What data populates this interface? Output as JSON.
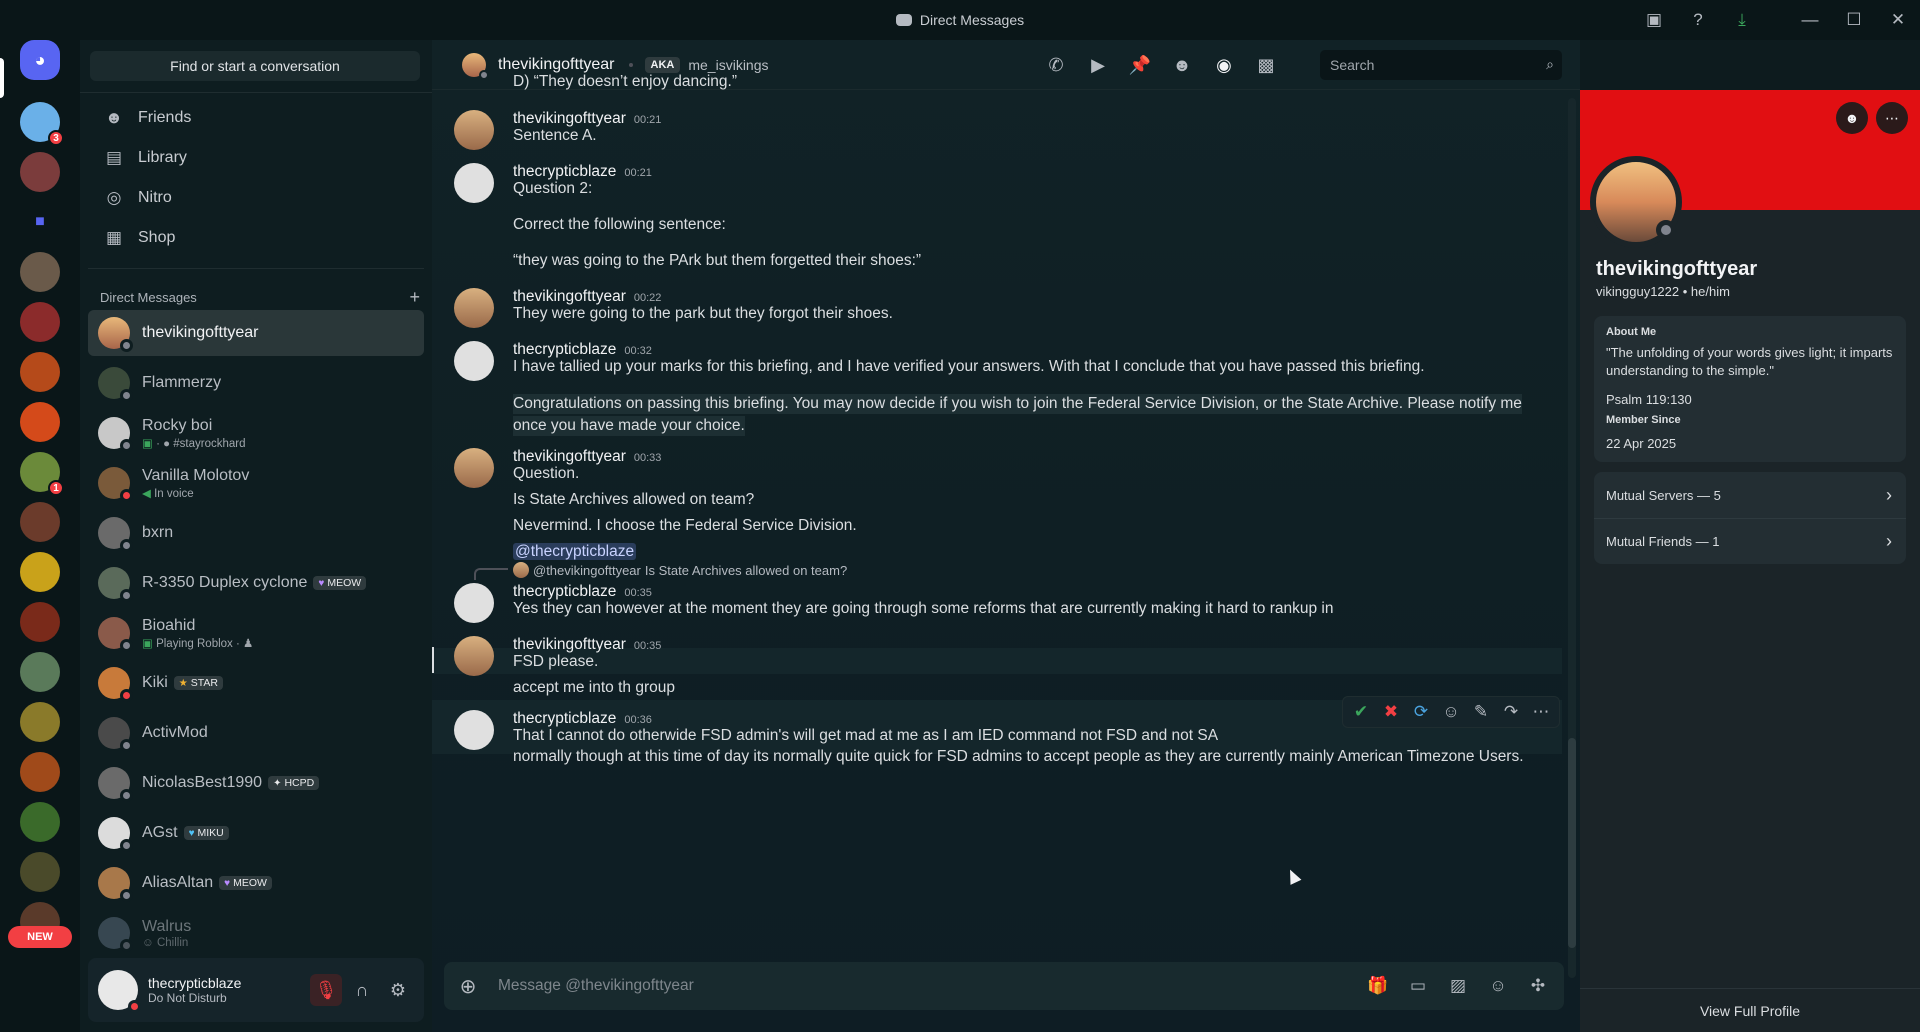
{
  "window": {
    "title": "Direct Messages"
  },
  "rail": {
    "badges": [
      "3",
      "1"
    ],
    "new_label": "NEW"
  },
  "sidebar": {
    "find_placeholder": "Find or start a conversation",
    "nav": [
      {
        "label": "Friends",
        "icon": "friends-icon"
      },
      {
        "label": "Library",
        "icon": "library-icon"
      },
      {
        "label": "Nitro",
        "icon": "nitro-icon"
      },
      {
        "label": "Shop",
        "icon": "shop-icon"
      }
    ],
    "dm_header": "Direct Messages",
    "dms": [
      {
        "name": "thevikingofttyear",
        "sub": "",
        "tag": "",
        "status": "offline"
      },
      {
        "name": "Flammerzy",
        "sub": "",
        "tag": "",
        "status": "offline"
      },
      {
        "name": "Rocky boi",
        "sub": "#stayrockhard",
        "tag": "",
        "status": "offline"
      },
      {
        "name": "Vanilla Molotov",
        "sub": "In voice",
        "tag": "",
        "status": "dnd"
      },
      {
        "name": "bxrn",
        "sub": "",
        "tag": "",
        "status": "offline"
      },
      {
        "name": "R-3350 Duplex cyclone",
        "sub": "",
        "tag": "MEOW",
        "status": "offline"
      },
      {
        "name": "Bioahid",
        "sub": "Playing Roblox ·",
        "tag": "",
        "status": "offline"
      },
      {
        "name": "Kiki",
        "sub": "",
        "tag": "STAR",
        "status": "dnd"
      },
      {
        "name": "ActivMod",
        "sub": "",
        "tag": "",
        "status": "offline"
      },
      {
        "name": "NicolasBest1990",
        "sub": "",
        "tag": "HCPD",
        "status": "offline"
      },
      {
        "name": "AGst",
        "sub": "",
        "tag": "MIKU",
        "status": "offline"
      },
      {
        "name": "AliasAltan",
        "sub": "",
        "tag": "MEOW",
        "status": "offline"
      },
      {
        "name": "Walrus",
        "sub": "Chillin",
        "tag": "",
        "status": "offline"
      }
    ]
  },
  "user_panel": {
    "name": "thecrypticblaze",
    "status": "Do Not Disturb"
  },
  "chat_header": {
    "name": "thevikingofttyear",
    "aka": "AKA",
    "alias": "me_isvikings",
    "search_placeholder": "Search"
  },
  "messages": {
    "top_line": "D) “They doesn’t enjoy dancing.”",
    "m1": {
      "author": "thevikingofttyear",
      "time": "00:21",
      "lines": [
        "Sentence A."
      ]
    },
    "m2": {
      "author": "thecrypticblaze",
      "time": "00:21",
      "lines": [
        "Question 2:",
        "Correct the following sentence:",
        "“they was going to the PArk but them forgetted their shoes:”"
      ]
    },
    "m3": {
      "author": "thevikingofttyear",
      "time": "00:22",
      "lines": [
        "They were going to the park but they forgot their shoes."
      ]
    },
    "m4": {
      "author": "thecrypticblaze",
      "time": "00:32",
      "lines": [
        "I have tallied up your marks for this briefing, and I have verified your answers. With that I conclude that you have passed this briefing.",
        "Congratulations on passing this briefing. You may now decide if you wish to join the Federal Service Division, or the State Archive. Please notify me",
        "once you have made your choice."
      ]
    },
    "m5": {
      "author": "thevikingofttyear",
      "time": "00:33",
      "lines": [
        "Question.",
        "Is State Archives allowed on team?",
        "Nevermind. I choose the Federal Service Division.",
        "@thecrypticblaze"
      ]
    },
    "m6": {
      "reply_mention": "@thevikingofttyear",
      "reply_text": "Is State Archives allowed on team?",
      "author": "thecrypticblaze",
      "time": "00:35",
      "lines": [
        "Yes they can however at the moment they are going through some reforms that are currently making it hard to rankup in"
      ]
    },
    "m7": {
      "author": "thevikingofttyear",
      "time": "00:35",
      "lines": [
        "FSD please.",
        "accept me into th group"
      ]
    },
    "m8": {
      "author": "thecrypticblaze",
      "time": "00:36",
      "lines": [
        "That I cannot do otherwide FSD admin's will get mad at me as I am IED command not FSD and not SA",
        "normally though at this time of day its normally quite quick for FSD admins to accept people as they are currently mainly American Timezone Users."
      ]
    }
  },
  "composer": {
    "placeholder": "Message @thevikingofttyear"
  },
  "profile": {
    "name": "thevikingofttyear",
    "username_pronouns": "vikingguy1222 • he/him",
    "about_label": "About Me",
    "about_text": "\"The unfolding of your words gives light; it imparts understanding to the simple.\"",
    "about_ref": "Psalm 119:130",
    "member_since_label": "Member Since",
    "member_since": "22 Apr 2025",
    "mutual_servers": "Mutual Servers — 5",
    "mutual_friends": "Mutual Friends — 1",
    "view_full": "View Full Profile"
  },
  "colors": {
    "banner": "#e10f12",
    "accent": "#5865f2",
    "dnd": "#f23f43"
  }
}
